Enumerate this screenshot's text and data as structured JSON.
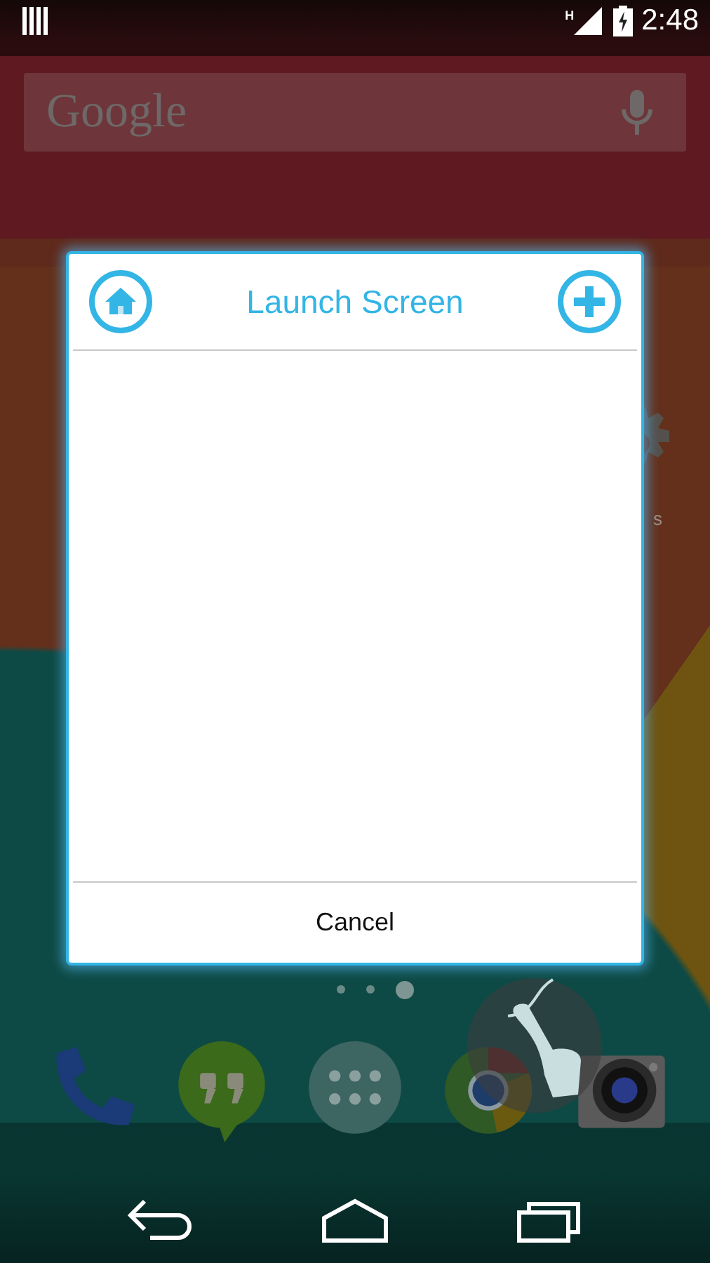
{
  "status_bar": {
    "network": "H",
    "time": "2:48"
  },
  "search": {
    "logo": "Google"
  },
  "widget": {
    "label": "s"
  },
  "dialog": {
    "title": "Launch Screen",
    "cancel": "Cancel"
  },
  "page_indicator": [
    {
      "selected": false
    },
    {
      "selected": false
    },
    {
      "selected": true
    }
  ],
  "dock": [
    {
      "kind": "phone"
    },
    {
      "kind": "hangouts"
    },
    {
      "kind": "apps"
    },
    {
      "kind": "chrome"
    },
    {
      "kind": "camera"
    }
  ],
  "nav": [
    {
      "kind": "back"
    },
    {
      "kind": "home"
    },
    {
      "kind": "recents"
    }
  ]
}
